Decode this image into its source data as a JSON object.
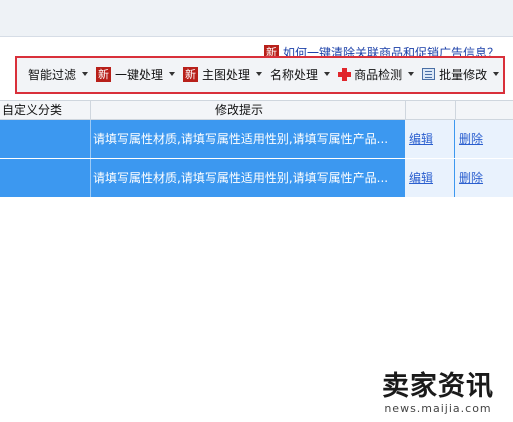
{
  "promo": {
    "badge": "新",
    "link_text": "如何一键清除关联商品和促销广告信息？"
  },
  "toolbar": {
    "items": [
      {
        "label": "智能过滤",
        "badge": "",
        "icon": ""
      },
      {
        "label": "一键处理",
        "badge": "新",
        "icon": ""
      },
      {
        "label": "主图处理",
        "badge": "新",
        "icon": ""
      },
      {
        "label": "名称处理",
        "badge": "",
        "icon": ""
      },
      {
        "label": "商品检测",
        "badge": "",
        "icon": "red-cross-icon"
      },
      {
        "label": "批量修改",
        "badge": "",
        "icon": "grid-icon"
      }
    ]
  },
  "table": {
    "headers": {
      "category": "自定义分类",
      "hint": "修改提示"
    },
    "rows": [
      {
        "hint": "请填写属性材质,请填写属性适用性别,请填写属性产品...",
        "edit": "编辑",
        "delete": "删除"
      },
      {
        "hint": "请填写属性材质,请填写属性适用性别,请填写属性产品...",
        "edit": "编辑",
        "delete": "删除"
      }
    ]
  },
  "watermark": {
    "main": "卖家资讯",
    "sub": "news.maijia.com"
  },
  "colors": {
    "row_selected": "#3c98f0",
    "toolbar_border": "#d9303a",
    "badge": "#b8201a",
    "link": "#1a3fa8"
  }
}
